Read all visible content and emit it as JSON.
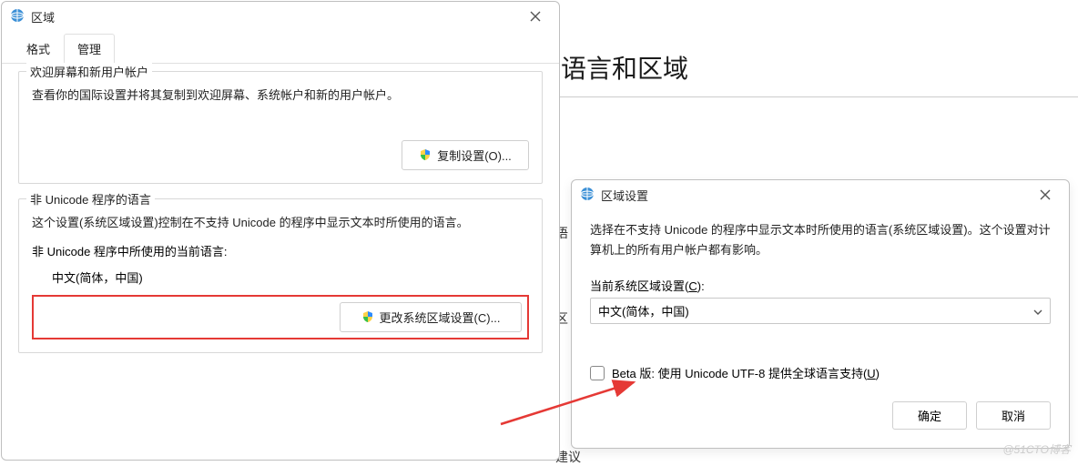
{
  "background_page": {
    "title_fragment": "语言和区域",
    "row_hint_1": "语",
    "row_hint_2": "区",
    "row_hint_3": "建议"
  },
  "region_dialog": {
    "title": "区域",
    "tabs": {
      "format": "格式",
      "admin": "管理"
    },
    "group1": {
      "title": "欢迎屏幕和新用户帐户",
      "text": "查看你的国际设置并将其复制到欢迎屏幕、系统帐户和新的用户帐户。",
      "copy_btn": "复制设置(O)..."
    },
    "group2": {
      "title": "非 Unicode 程序的语言",
      "text": "这个设置(系统区域设置)控制在不支持 Unicode 的程序中显示文本时所使用的语言。",
      "current_label": "非 Unicode 程序中所使用的当前语言:",
      "current_value": "中文(简体，中国)",
      "change_btn": "更改系统区域设置(C)..."
    }
  },
  "locale_dialog": {
    "title": "区域设置",
    "desc": "选择在不支持 Unicode 的程序中显示文本时所使用的语言(系统区域设置)。这个设置对计算机上的所有用户帐户都有影响。",
    "select_label_prefix": "当前系统区域设置(",
    "select_label_hotkey": "C",
    "select_label_suffix": "):",
    "select_value": "中文(简体，中国)",
    "checkbox_prefix": "Beta 版: 使用 Unicode UTF-8 提供全球语言支持(",
    "checkbox_hotkey": "U",
    "checkbox_suffix": ")",
    "ok": "确定",
    "cancel": "取消"
  },
  "watermark": "@51CTO博客"
}
